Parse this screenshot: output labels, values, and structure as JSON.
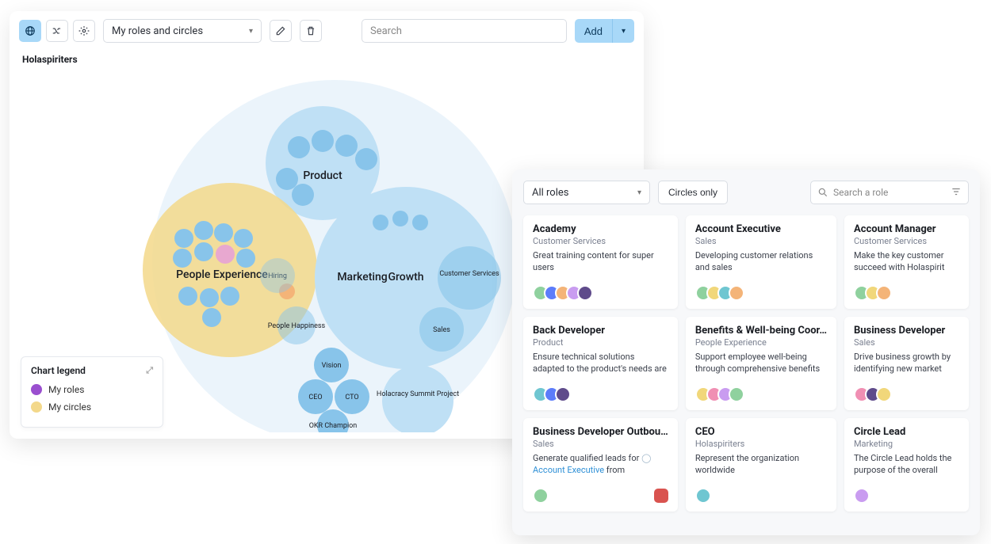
{
  "map": {
    "toolbar": {
      "filter_label": "My roles and circles",
      "search_placeholder": "Search",
      "add_label": "Add"
    },
    "org_name": "Holaspiriters",
    "circles": {
      "product": "Product",
      "people_experience": "People Experience",
      "hiring": "Hiring",
      "people_happiness": "People Happiness",
      "marketing": "Marketing",
      "growth": "Growth",
      "customer_services": "Customer Services",
      "sales": "Sales",
      "vision": "Vision",
      "ceo": "CEO",
      "cto": "CTO",
      "okr_champion": "OKR Champion",
      "holacracy_summit": "Holacracy Summit Project"
    },
    "legend": {
      "title": "Chart legend",
      "item1": "My roles",
      "item2": "My circles"
    }
  },
  "roles": {
    "toolbar": {
      "filter_label": "All roles",
      "circles_only": "Circles only",
      "search_placeholder": "Search a role"
    },
    "cards": [
      {
        "title": "Academy",
        "circle": "Customer Services",
        "desc": "Great training content for super users",
        "avatars": 5
      },
      {
        "title": "Account Executive",
        "circle": "Sales",
        "desc": "Developing customer relations and sales",
        "avatars": 4
      },
      {
        "title": "Account Manager",
        "circle": "Customer Services",
        "desc": "Make the key customer succeed with Holaspirit",
        "avatars": 3
      },
      {
        "title": "Back Developer",
        "circle": "Product",
        "desc": "Ensure technical solutions adapted to the product's needs are put in",
        "avatars": 3
      },
      {
        "title": "Benefits & Well-being Coor…",
        "circle": "People Experience",
        "desc": "Support employee well-being through comprehensive benefits",
        "avatars": 4
      },
      {
        "title": "Business Developer",
        "circle": "Sales",
        "desc": "Drive business growth by identifying new market",
        "avatars": 3
      },
      {
        "title": "Business Developer Outbou…",
        "circle": "Sales",
        "desc_prefix": "Generate qualified leads for ",
        "desc_link": "Account Executive",
        "desc_suffix": " from",
        "avatars": 1,
        "badge": true
      },
      {
        "title": "CEO",
        "circle": "Holaspiriters",
        "desc": "Represent the organization worldwide",
        "avatars": 1
      },
      {
        "title": "Circle Lead",
        "circle": "Marketing",
        "desc": "The Circle Lead holds the purpose of the overall circle.",
        "avatars": 1
      }
    ]
  }
}
